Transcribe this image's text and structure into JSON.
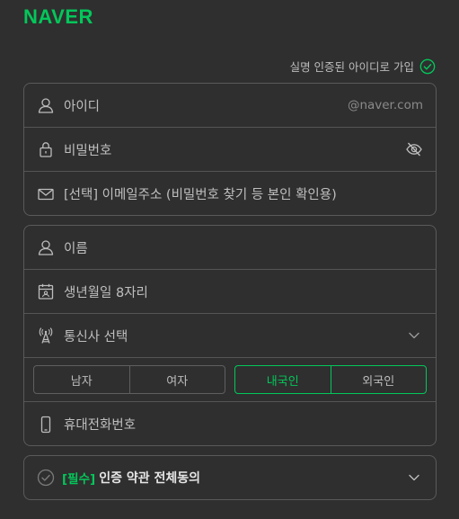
{
  "brand": {
    "logo": "NAVER"
  },
  "verified": {
    "label": "실명 인증된 아이디로 가입"
  },
  "account": {
    "id_label": "아이디",
    "id_suffix": "@naver.com",
    "password_label": "비밀번호",
    "email_label": "[선택] 이메일주소 (비밀번호 찾기 등 본인 확인용)"
  },
  "profile": {
    "name_label": "이름",
    "birth_label": "생년월일 8자리",
    "carrier_label": "통신사 선택",
    "gender": {
      "male": "남자",
      "female": "여자"
    },
    "nationality": {
      "domestic": "내국인",
      "foreign": "외국인",
      "selected": "내국인"
    },
    "phone_label": "휴대전화번호"
  },
  "agreement": {
    "tag": "[필수]",
    "label": "인증 약관 전체동의"
  },
  "colors": {
    "accent": "#03c75a",
    "background": "#2f2f2f",
    "border": "#5a5a5a"
  },
  "icons": [
    "check-circle-icon",
    "user-icon",
    "lock-icon",
    "eye-off-icon",
    "mail-icon",
    "calendar-icon",
    "antenna-icon",
    "chevron-down-icon",
    "phone-icon"
  ]
}
